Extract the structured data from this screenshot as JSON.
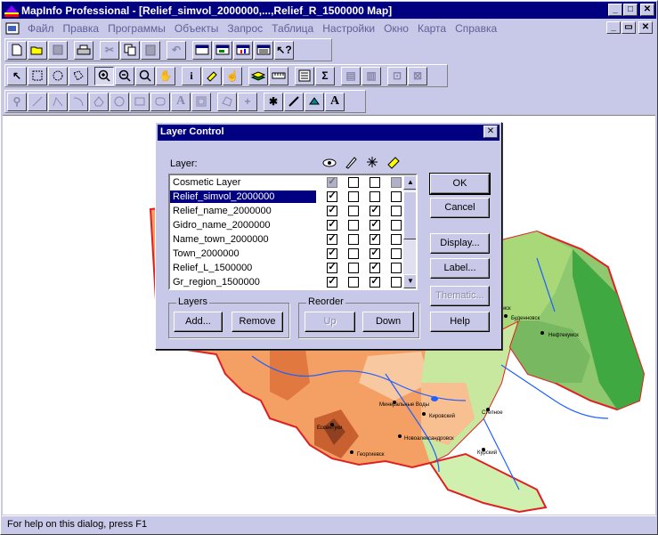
{
  "app": {
    "title": "MapInfo Professional - [Relief_simvol_2000000,...,Relief_R_1500000 Map]"
  },
  "window_controls": {
    "minimize": "_",
    "maximize": "□",
    "close": "✕",
    "restore": "▭"
  },
  "menu": [
    "Файл",
    "Правка",
    "Программы",
    "Объекты",
    "Запрос",
    "Таблица",
    "Настройки",
    "Окно",
    "Карта",
    "Справка"
  ],
  "dialog": {
    "title": "Layer Control",
    "layer_header": "Layer:",
    "layers": [
      {
        "name": "Cosmetic Layer",
        "visible": true,
        "editable": false,
        "selectable": false,
        "label": false,
        "cosmetic": true
      },
      {
        "name": "Relief_simvol_2000000",
        "visible": true,
        "editable": false,
        "selectable": false,
        "label": false,
        "selected": true
      },
      {
        "name": "Relief_name_2000000",
        "visible": true,
        "editable": false,
        "selectable": true,
        "label": false
      },
      {
        "name": "Gidro_name_2000000",
        "visible": true,
        "editable": false,
        "selectable": true,
        "label": false
      },
      {
        "name": "Name_town_2000000",
        "visible": true,
        "editable": false,
        "selectable": true,
        "label": false
      },
      {
        "name": "Town_2000000",
        "visible": true,
        "editable": false,
        "selectable": true,
        "label": false
      },
      {
        "name": "Relief_L_1500000",
        "visible": true,
        "editable": false,
        "selectable": true,
        "label": false
      },
      {
        "name": "Gr_region_1500000",
        "visible": true,
        "editable": false,
        "selectable": true,
        "label": false
      }
    ],
    "buttons": {
      "ok": "OK",
      "cancel": "Cancel",
      "display": "Display...",
      "label": "Label...",
      "thematic": "Thematic...",
      "help": "Help"
    },
    "layers_group": {
      "title": "Layers",
      "add": "Add...",
      "remove": "Remove"
    },
    "reorder_group": {
      "title": "Reorder",
      "up": "Up",
      "down": "Down"
    }
  },
  "map_labels": [
    "Нефтекумск",
    "Ессентуки",
    "Минеральные Воды",
    "Буденновск",
    "Степное",
    "Кировский",
    "Новоалександровск",
    "Курский",
    "Зеленокумск",
    "Георгиевск"
  ],
  "status": {
    "text": "For help on this dialog, press F1"
  },
  "colors": {
    "title_bar": "#000080",
    "window_bg": "#c8c8e8",
    "selection": "#000080"
  }
}
